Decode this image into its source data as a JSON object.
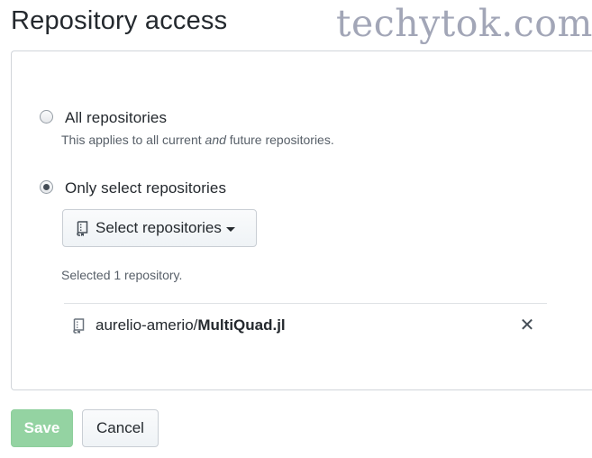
{
  "page": {
    "title": "Repository access",
    "watermark": "techytok.com"
  },
  "options": {
    "all": {
      "label": "All repositories",
      "note_before": "This applies to all current ",
      "note_emphasis": "and",
      "note_after": " future repositories.",
      "selected": false
    },
    "select": {
      "label": "Only select repositories",
      "selected": true
    }
  },
  "select_button": {
    "label": "Select repositories",
    "icon": "repo-icon"
  },
  "selection": {
    "summary": "Selected 1 repository.",
    "repos": [
      {
        "owner": "aurelio-amerio/",
        "name": "MultiQuad.jl",
        "icon": "repo-icon",
        "remove_glyph": "✕"
      }
    ]
  },
  "actions": {
    "save_label": "Save",
    "save_enabled": false,
    "cancel_label": "Cancel"
  },
  "colors": {
    "save_button_disabled": "#94d3a2",
    "text_primary": "#24292e",
    "text_muted": "#586069"
  }
}
